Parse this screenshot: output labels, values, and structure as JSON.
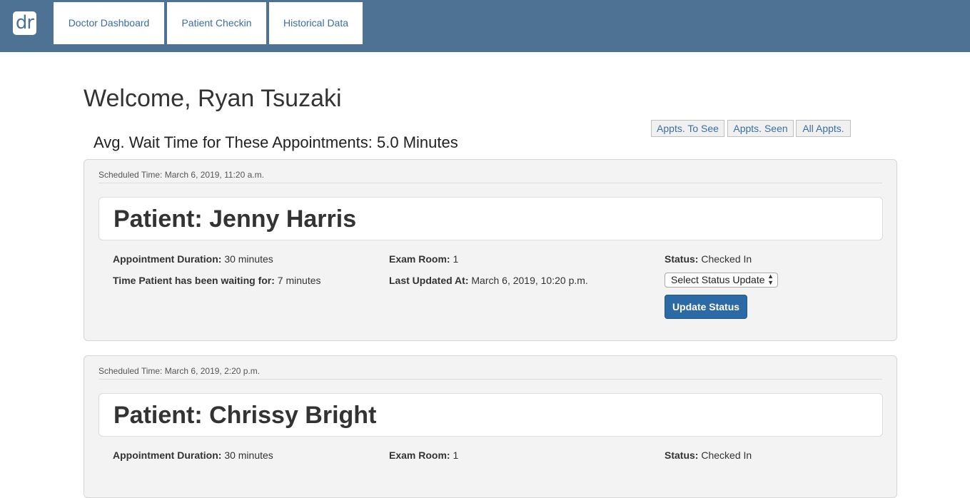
{
  "nav": {
    "logo": "dr",
    "tabs": [
      "Doctor Dashboard",
      "Patient Checkin",
      "Historical Data"
    ]
  },
  "welcome": "Welcome, Ryan Tsuzaki",
  "filters": [
    "Appts. To See",
    "Appts. Seen",
    "All Appts."
  ],
  "avg_wait": "Avg. Wait Time for These Appointments: 5.0 Minutes",
  "labels": {
    "duration": "Appointment Duration:",
    "waiting": "Time Patient has been waiting for:",
    "exam_room": "Exam Room:",
    "last_updated": "Last Updated At:",
    "status": "Status:",
    "select_placeholder": "Select Status Update",
    "update_button": "Update Status"
  },
  "appointments": [
    {
      "scheduled": "Scheduled Time: March 6, 2019, 11:20 a.m.",
      "patient": "Patient: Jenny Harris",
      "duration": "30 minutes",
      "waiting": "7 minutes",
      "exam_room": "1",
      "last_updated": "March 6, 2019, 10:20 p.m.",
      "status": "Checked In"
    },
    {
      "scheduled": "Scheduled Time: March 6, 2019, 2:20 p.m.",
      "patient": "Patient: Chrissy Bright",
      "duration": "30 minutes",
      "exam_room": "1",
      "status": "Checked In"
    }
  ]
}
